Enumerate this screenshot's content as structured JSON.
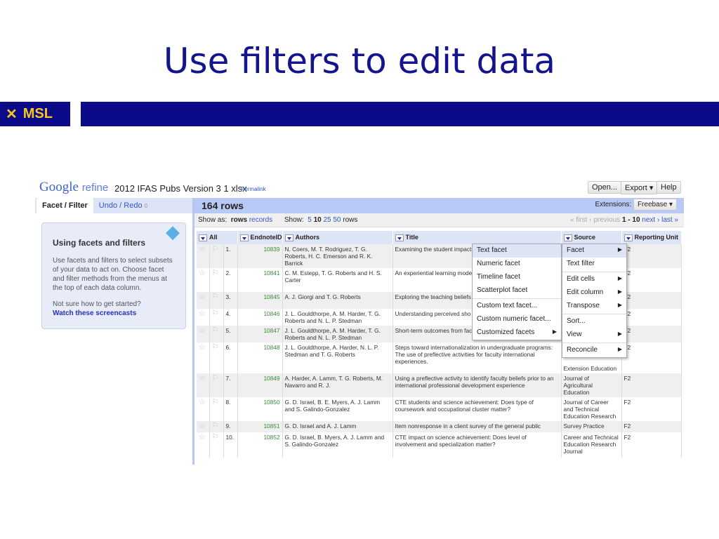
{
  "slide": {
    "title": "Use filters to edit data",
    "logo_text": "MSL"
  },
  "app": {
    "brand_google": "Google",
    "brand_refine": "refine",
    "project": "2012 IFAS Pubs Version 3 1 xlsx",
    "permalink": "Permalink",
    "open": "Open...",
    "export": "Export ▾",
    "help": "Help"
  },
  "left": {
    "tab_facet": "Facet / Filter",
    "tab_undo": "Undo / Redo",
    "undo_count": "0",
    "help_title": "Using facets and filters",
    "help_text": "Use facets and filters to select subsets of your data to act on. Choose facet and filter methods from the menus at the top of each data column.",
    "help_q": "Not sure how to get started?",
    "help_link": "Watch these screencasts"
  },
  "main": {
    "rows_count": "164 rows",
    "extensions_label": "Extensions:",
    "freebase": "Freebase ▾",
    "show_as": "Show as:",
    "rows": "rows",
    "records": "records",
    "show": "Show:",
    "sizes": [
      "5",
      "10",
      "25",
      "50"
    ],
    "rows_suffix": "rows",
    "first": "« first",
    "previous": "‹ previous",
    "range": "1 - 10",
    "next": "next ›",
    "last": "last »"
  },
  "columns": [
    "All",
    "EndnoteID",
    "Authors",
    "Title",
    "Source",
    "Reporting Unit"
  ],
  "rows": [
    {
      "n": "1.",
      "id": "10839",
      "authors": "N. Coers, M. T. Rodriguez, T. G. Roberts, H. C. Emerson and R. K. Barrick",
      "title": "Examining the student impacts experiences",
      "source": "",
      "unit": "F2"
    },
    {
      "n": "2.",
      "id": "10841",
      "authors": "C. M. Estepp, T. G. Roberts and H. S. Carter",
      "title": "An experiential learning mode improve teaching",
      "source": "",
      "unit": "F2"
    },
    {
      "n": "3.",
      "id": "10845",
      "authors": "A. J. Giorgi and T. G. Roberts",
      "title": "Exploring the teaching beliefs professors",
      "source": "",
      "unit": "F2"
    },
    {
      "n": "4.",
      "id": "10846",
      "authors": "J. L. Gouldthorpe, A. M. Harder, T. G. Roberts and N. L. P. Stedman",
      "title": "Understanding perceived sho travel abroad experience in E",
      "source": "",
      "unit": "F2"
    },
    {
      "n": "5.",
      "id": "10847",
      "authors": "J. L. Gouldthorpe, A. M. Harder, T. G. Roberts and N. L. P. Stedman",
      "title": "Short-term outcomes from fac",
      "source": "",
      "unit": "F2"
    },
    {
      "n": "6.",
      "id": "10848",
      "authors": "J. L. Gouldthorpe, A. Harder, N. L. P. Stedman and T. G. Roberts",
      "title": "Steps toward internationalization in undergraduate programs: The use of preflective activities for faculty international experiences.",
      "source": "Extension Education",
      "unit": "F2"
    },
    {
      "n": "7.",
      "id": "10849",
      "authors": "A. Harder, A. Lamm, T. G. Roberts, M. Navarro and R. J.",
      "title": "Using a preflective activity to identify faculty beliefs prior to an international professional development experience",
      "source": "Journal of Agricultural Education",
      "unit": "F2"
    },
    {
      "n": "8.",
      "id": "10850",
      "authors": "G. D. Israel, B. E. Myers, A. J. Lamm and S. Galindo-Gonzalez",
      "title": "CTE students and science achievement: Does type of coursework and occupational cluster matter?",
      "source": "Journal of Career and Technical Education Research",
      "unit": "F2"
    },
    {
      "n": "9.",
      "id": "10851",
      "authors": "G. D. Israel and A. J. Lamm",
      "title": "Item nonresponse in a client survey of the general public",
      "source": "Survey Practice",
      "unit": "F2"
    },
    {
      "n": "10.",
      "id": "10852",
      "authors": "G. D. Israel, B. Myers, A. J. Lamm and S. Galindo-Gonzalez",
      "title": "CTE impact on science achievement: Does level of involvement and specialization matter?",
      "source": "Career and Technical Education Research Journal",
      "unit": "F2"
    }
  ],
  "column_menu": [
    "Facet",
    "Text filter",
    "Edit cells",
    "Edit column",
    "Transpose",
    "Sort...",
    "View",
    "Reconcile"
  ],
  "facet_menu": [
    "Text facet",
    "Numeric facet",
    "Timeline facet",
    "Scatterplot facet",
    "Custom text facet...",
    "Custom numeric facet...",
    "Customized facets"
  ]
}
